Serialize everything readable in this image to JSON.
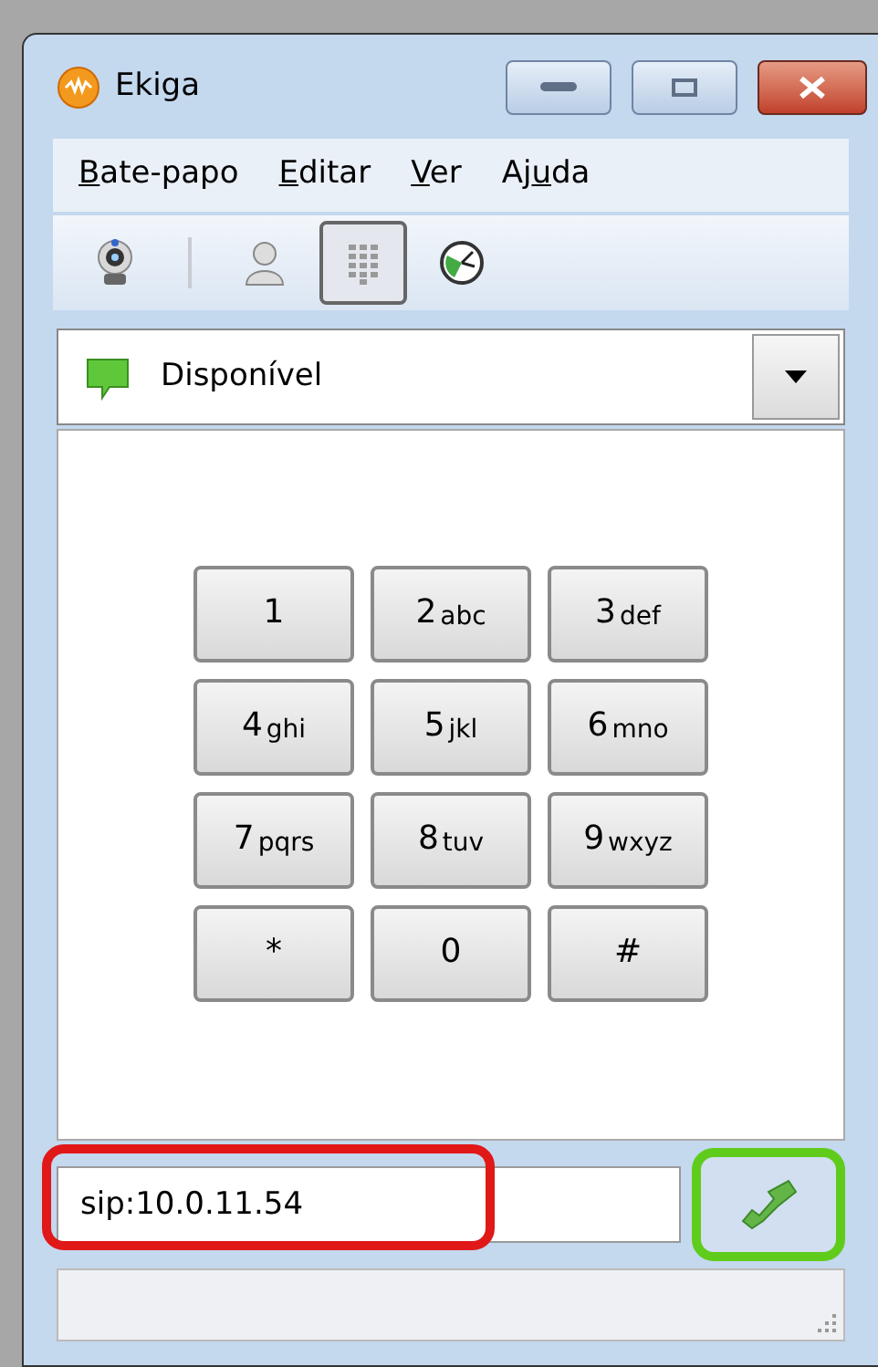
{
  "window": {
    "title": "Ekiga"
  },
  "menu": [
    {
      "key": "B",
      "after": "ate-papo"
    },
    {
      "key": "E",
      "after": "ditar"
    },
    {
      "key": "V",
      "after": "er"
    },
    {
      "before": "Aj",
      "key": "u",
      "after": "da"
    }
  ],
  "toolbar": [
    {
      "kind": "webcam",
      "selected": false
    },
    {
      "kind": "separator"
    },
    {
      "kind": "contacts",
      "selected": false
    },
    {
      "kind": "dialpad",
      "selected": true
    },
    {
      "kind": "history",
      "selected": false
    }
  ],
  "presence": {
    "value": "Disponível"
  },
  "keypad": [
    {
      "digit": "1"
    },
    {
      "digit": "2",
      "letters": "abc"
    },
    {
      "digit": "3",
      "letters": "def"
    },
    {
      "digit": "4",
      "letters": "ghi"
    },
    {
      "digit": "5",
      "letters": "jkl"
    },
    {
      "digit": "6",
      "letters": "mno"
    },
    {
      "digit": "7",
      "letters": "pqrs"
    },
    {
      "digit": "8",
      "letters": "tuv"
    },
    {
      "digit": "9",
      "letters": "wxyz"
    },
    {
      "digit": "*"
    },
    {
      "digit": "0"
    },
    {
      "digit": "#"
    }
  ],
  "dial": {
    "value": "sip:10.0.11.54",
    "highlighted": true
  },
  "call_button": {
    "highlighted": true
  }
}
